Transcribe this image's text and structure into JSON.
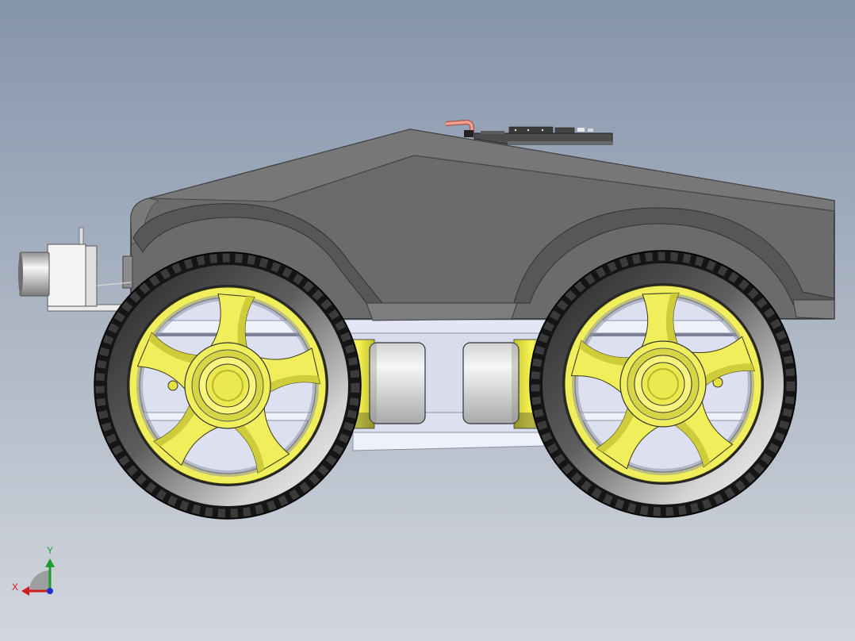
{
  "viewport": {
    "triad": {
      "x_label": "X",
      "y_label": "Y"
    }
  },
  "colors": {
    "background-top": "#8595ab",
    "background-bottom": "#d3d6dd",
    "axis-x": "#d01e1e",
    "axis-y": "#1c9c2c",
    "axis-z": "#1e2ed0",
    "body": "#6b6b6b",
    "rim": "#f0ee5a",
    "tire": "#151515",
    "chassis": "#dde0f1"
  }
}
